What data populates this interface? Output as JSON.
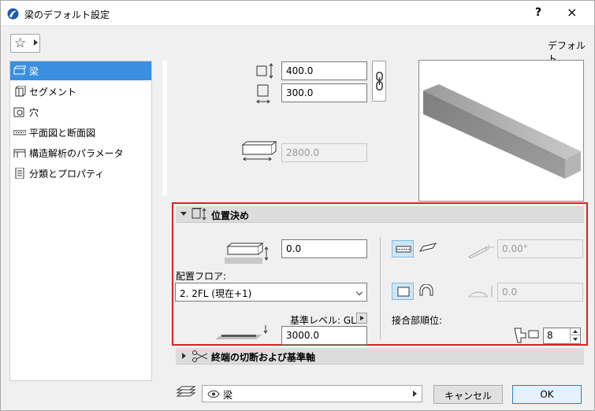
{
  "window": {
    "title": "梁のデフォルト設定",
    "help": "?",
    "close": "×"
  },
  "toolbar": {
    "default_label": "デフォルト"
  },
  "sidebar": {
    "items": [
      {
        "label": "梁",
        "active": true
      },
      {
        "label": "セグメント"
      },
      {
        "label": "穴"
      },
      {
        "label": "平面図と断面図"
      },
      {
        "label": "構造解析のパラメータ"
      },
      {
        "label": "分類とプロパティ"
      }
    ]
  },
  "geometry": {
    "height": "400.0",
    "width": "300.0",
    "length": "2800.0"
  },
  "positioning": {
    "header": "位置決め",
    "offset": "0.0",
    "floor_label": "配置フロア:",
    "floor_value": "2. 2FL (現在+1)",
    "ref_level_label": "基準レベル: GL",
    "ref_offset": "3000.0",
    "angle": "0.00°",
    "arch": "0.0",
    "priority_label": "接合部順位:",
    "priority_value": "8"
  },
  "end_cut": {
    "header": "終端の切断および基準軸"
  },
  "footer": {
    "layer": "梁",
    "cancel": "キャンセル",
    "ok": "OK"
  },
  "colors": {
    "selection": "#3a8fe0",
    "highlight_frame": "#e02020",
    "toggle_active": "#cde6f7"
  }
}
